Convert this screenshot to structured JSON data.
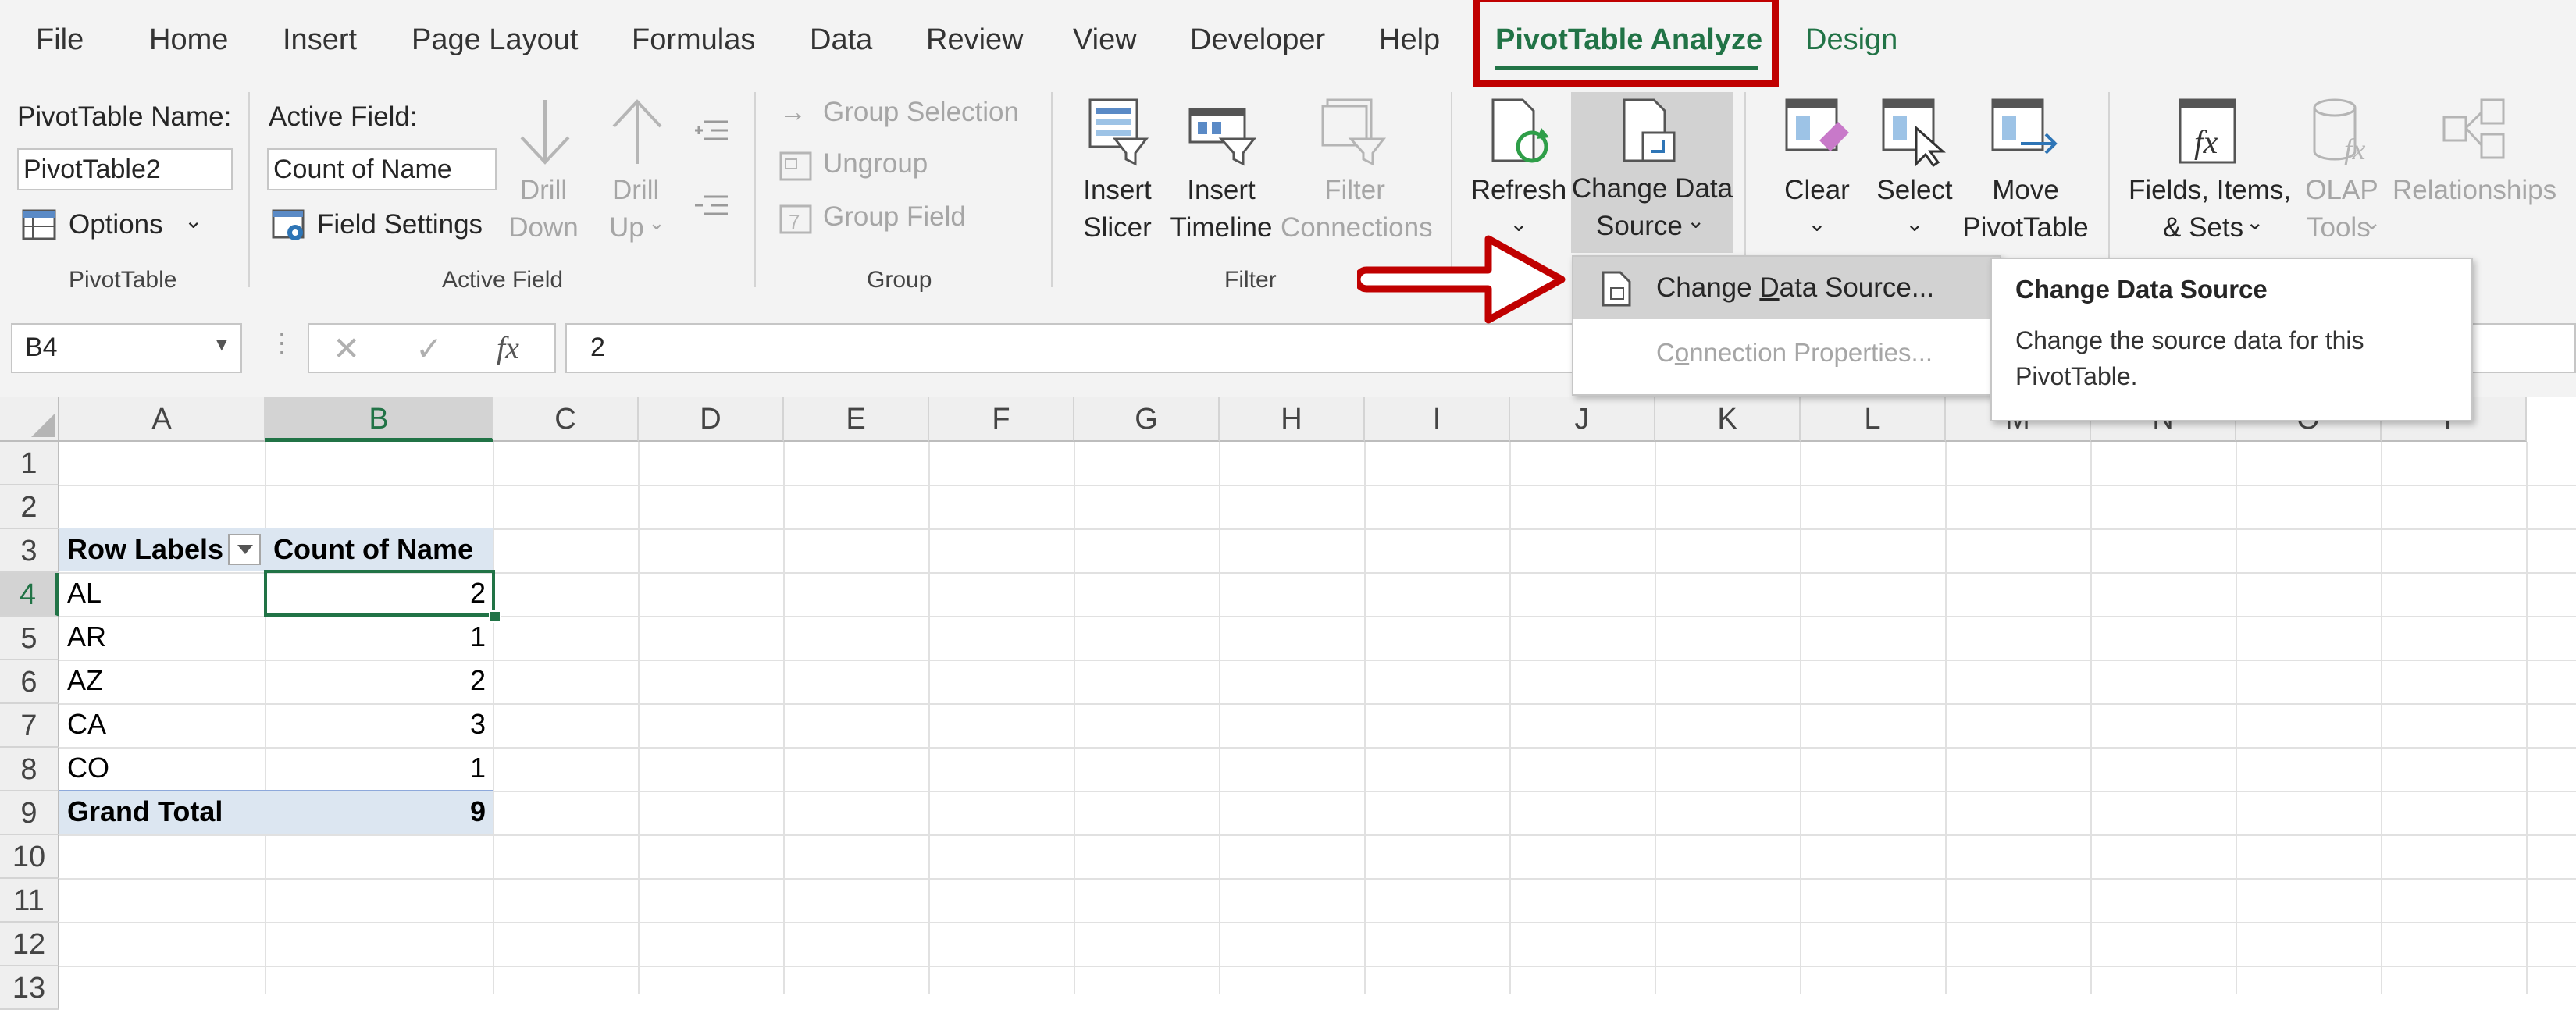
{
  "tabs": {
    "file": "File",
    "home": "Home",
    "insert": "Insert",
    "page_layout": "Page Layout",
    "formulas": "Formulas",
    "data": "Data",
    "review": "Review",
    "view": "View",
    "developer": "Developer",
    "help": "Help",
    "pivottable_analyze": "PivotTable Analyze",
    "design": "Design"
  },
  "ribbon": {
    "pivottable_group": {
      "name_label": "PivotTable Name:",
      "name_value": "PivotTable2",
      "options_label": "Options",
      "group_label": "PivotTable"
    },
    "active_field_group": {
      "field_label": "Active Field:",
      "field_value": "Count of Name",
      "field_settings_label": "Field Settings",
      "drill_down_line1": "Drill",
      "drill_down_line2": "Down",
      "drill_up_line1": "Drill",
      "drill_up_line2": "Up",
      "group_label": "Active Field"
    },
    "group_group": {
      "group_selection": "Group Selection",
      "ungroup": "Ungroup",
      "group_field": "Group Field",
      "group_label": "Group"
    },
    "filter_group": {
      "insert_slicer_line1": "Insert",
      "insert_slicer_line2": "Slicer",
      "insert_timeline_line1": "Insert",
      "insert_timeline_line2": "Timeline",
      "filter_connections_line1": "Filter",
      "filter_connections_line2": "Connections",
      "group_label": "Filter"
    },
    "data_group": {
      "refresh_label": "Refresh",
      "change_source_line1": "Change Data",
      "change_source_line2": "Source"
    },
    "actions_group": {
      "clear_label": "Clear",
      "select_label": "Select",
      "move_line1": "Move",
      "move_line2": "PivotTable"
    },
    "calculations_group": {
      "fields_items_line1": "Fields, Items,",
      "fields_items_line2": "& Sets",
      "olap_line1": "OLAP",
      "olap_line2": "Tools",
      "relationships_label": "Relationships"
    }
  },
  "dropdown": {
    "change_data_source_pre": "Change ",
    "change_data_source_ul": "D",
    "change_data_source_post": "ata Source...",
    "connection_props_pre": "C",
    "connection_props_ul": "o",
    "connection_props_post": "nnection Properties..."
  },
  "tooltip": {
    "title": "Change Data Source",
    "line1": "Change the source data for this",
    "line2": "PivotTable."
  },
  "formula_bar": {
    "name_box": "B4",
    "fx_label": "fx",
    "formula": "2"
  },
  "sheet": {
    "columns": [
      "A",
      "B",
      "C",
      "D",
      "E",
      "F",
      "G",
      "H",
      "I",
      "J",
      "K",
      "L",
      "M",
      "N",
      "O",
      "P"
    ],
    "rows": [
      "1",
      "2",
      "3",
      "4",
      "5",
      "6",
      "7",
      "8",
      "9",
      "10",
      "11",
      "12",
      "13"
    ],
    "header_row_label": "Row Labels",
    "header_value": "Count of Name",
    "data": [
      {
        "label": "AL",
        "value": "2"
      },
      {
        "label": "AR",
        "value": "1"
      },
      {
        "label": "AZ",
        "value": "2"
      },
      {
        "label": "CA",
        "value": "3"
      },
      {
        "label": "CO",
        "value": "1"
      }
    ],
    "grand_total_label": "Grand Total",
    "grand_total_value": "9"
  },
  "colors": {
    "accent_green": "#217346",
    "annotation_red": "#c00000",
    "pivot_header_fill": "#dce6f1"
  }
}
